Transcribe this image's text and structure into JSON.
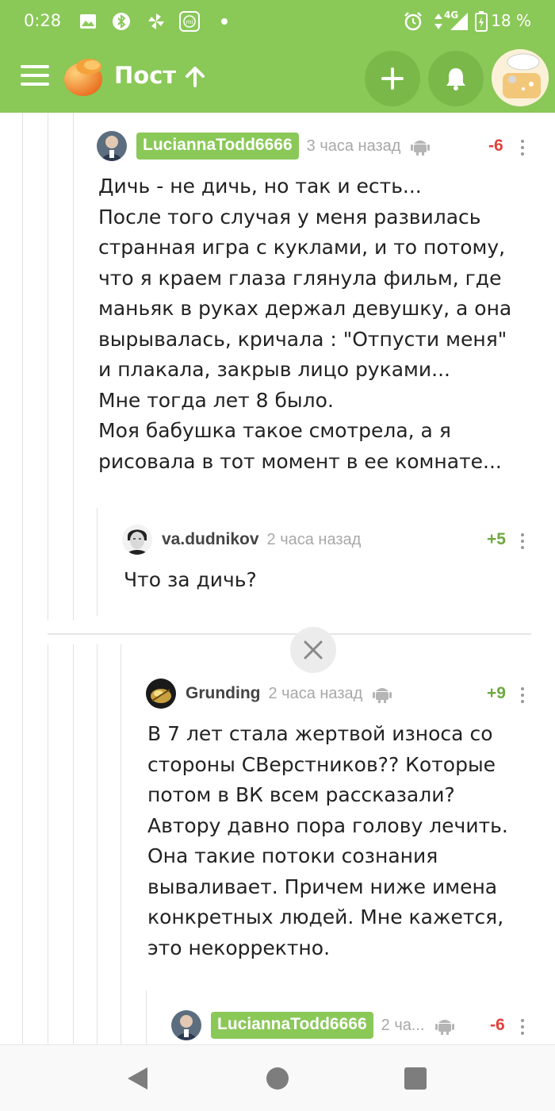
{
  "status_bar": {
    "time": "0:28",
    "network": "4G",
    "battery": "18 %"
  },
  "header": {
    "title": "Пост",
    "icons": [
      "menu-icon",
      "pikabu-logo",
      "arrow-up-icon",
      "plus-icon",
      "bell-icon",
      "user-avatar"
    ]
  },
  "colors": {
    "brand_green": "#8ac858",
    "negative": "#e2403a",
    "positive": "#6fa840"
  },
  "comments": [
    {
      "author": "LuciannaTodd6666",
      "time": "3 часа назад",
      "rating": "-6",
      "text": "Дичь - не дичь, но так и есть...\nПосле того случая у меня развилась странная игра с куклами, и то потому, что я краем глаза глянула фильм, где маньяк в руках держал девушку, а она вырывалась, кричала : \"Отпусти меня\" и плакала, закрыв лицо руками...\nМне тогда лет 8 было.\nМоя бабушка такое смотрела, а я рисовала в тот момент в ее комнате..."
    },
    {
      "author": "va.dudnikov",
      "time": "2 часа назад",
      "rating": "+5",
      "text": "Что за дичь?"
    },
    {
      "author": "Grunding",
      "time": "2 часа назад",
      "rating": "+9",
      "text": "В 7 лет стала жертвой износа со стороны СВерстников?? Которые потом в ВК всем рассказали? Автору давно пора голову лечить. Она такие потоки сознания вываливает. Причем ниже имена конкретных людей. Мне кажется, это некорректно."
    },
    {
      "author": "LuciannaTodd6666",
      "time": "2 ча...",
      "rating": "-6",
      "text": ""
    }
  ]
}
